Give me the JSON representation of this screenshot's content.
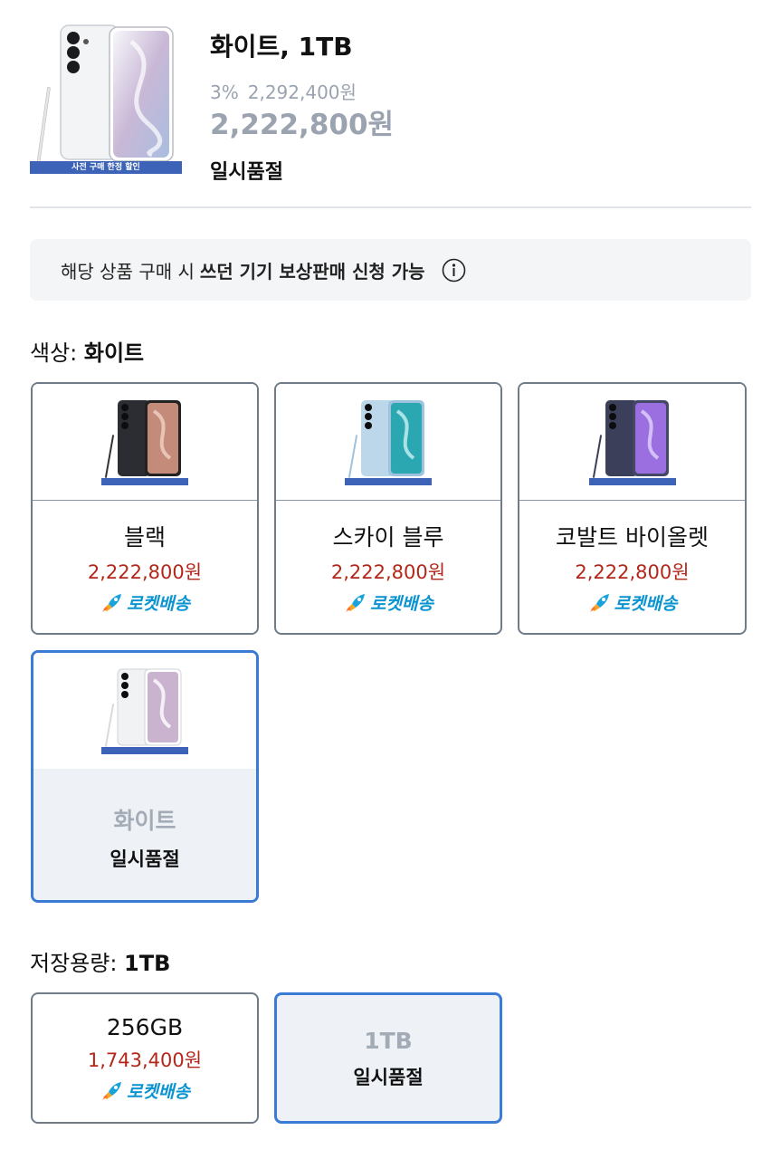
{
  "product": {
    "title": "화이트, 1TB",
    "discount_percent": "3%",
    "original_price": "2,292,400원",
    "sale_price": "2,222,800원",
    "status": "일시품절",
    "image_banner_text": "사전 구매 한정 할인"
  },
  "notice": {
    "text_prefix": "해당 상품 구매 시",
    "text_bold": "쓰던 기기 보상판매 신청 가능",
    "icon": "info-icon"
  },
  "color_section": {
    "label": "색상:",
    "selected_value": "화이트",
    "options": [
      {
        "name": "블랙",
        "price": "2,222,800원",
        "delivery": "로켓배송",
        "screen_color": "#c48a7a",
        "body_color": "#2b2d33"
      },
      {
        "name": "스카이 블루",
        "price": "2,222,800원",
        "delivery": "로켓배송",
        "screen_color": "#2aa7b1",
        "body_color": "#bcd6ea"
      },
      {
        "name": "코발트 바이올렛",
        "price": "2,222,800원",
        "delivery": "로켓배송",
        "screen_color": "#9b6fe0",
        "body_color": "#3c3f5a"
      },
      {
        "name": "화이트",
        "status": "일시품절",
        "selected": true,
        "screen_color": "#c9b3cf",
        "body_color": "#f1f2f4"
      }
    ]
  },
  "storage_section": {
    "label": "저장용량:",
    "selected_value": "1TB",
    "options": [
      {
        "name": "256GB",
        "price": "1,743,400원",
        "delivery": "로켓배송"
      },
      {
        "name": "1TB",
        "status": "일시품절",
        "selected": true
      }
    ]
  },
  "colors": {
    "accent_blue": "#3a7bd5",
    "price_red": "#b3271b",
    "rocket_blue": "#0a93d1",
    "muted_gray": "#9aa3af"
  }
}
